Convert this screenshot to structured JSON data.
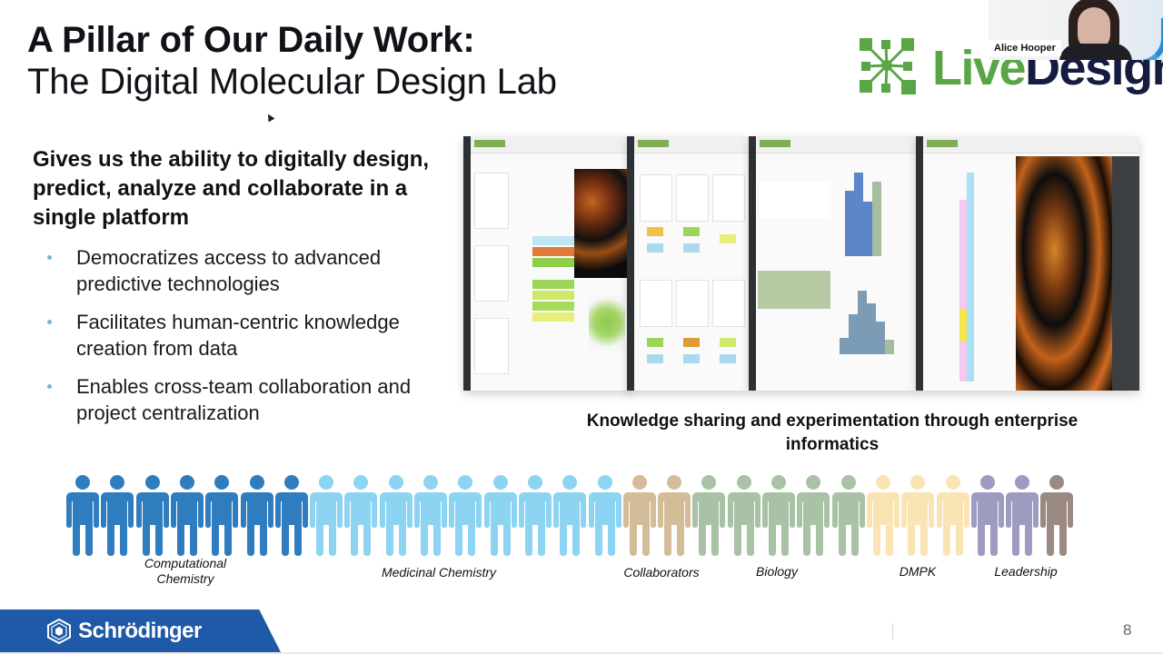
{
  "slide": {
    "title_line1": "A Pillar of Our Daily Work:",
    "title_line2": "The Digital Molecular Design Lab",
    "lead": "Gives us the ability to digitally design, predict, analyze and collaborate in a single platform",
    "bullets": [
      "Democratizes access to advanced predictive technologies",
      "Facilitates human-centric knowledge creation from data",
      "Enables cross-team collaboration and project centralization"
    ],
    "caption": "Knowledge sharing and experimentation through enterprise informatics",
    "page_number": "8"
  },
  "logo": {
    "live": "Live",
    "design": "Design",
    "icon": "network-node-icon",
    "color_live": "#5aa646",
    "color_design": "#151c3f"
  },
  "video": {
    "participant_name": "Alice Hooper"
  },
  "screenshots": [
    {
      "name": "compound-detail-view"
    },
    {
      "name": "compound-grid-view"
    },
    {
      "name": "histogram-analysis-view"
    },
    {
      "name": "protein-structure-view"
    }
  ],
  "groups": [
    {
      "label": "Computational Chemistry",
      "count": 7,
      "color": "#2f7dbf"
    },
    {
      "label": "Medicinal Chemistry",
      "count": 9,
      "color": "#8dd3f2"
    },
    {
      "label": "Collaborators",
      "count": 2,
      "color": "#d3bd98"
    },
    {
      "label": "Biology",
      "count": 5,
      "color": "#a9c2a6"
    },
    {
      "label": "DMPK",
      "count": 3,
      "color": "#fbe4b4"
    },
    {
      "label": "Leadership",
      "count": 3,
      "color": "#9d9bc0",
      "accent_last": "#9a8a82"
    }
  ],
  "footer": {
    "brand": "Schrödinger",
    "brand_color": "#1e5aa8"
  }
}
